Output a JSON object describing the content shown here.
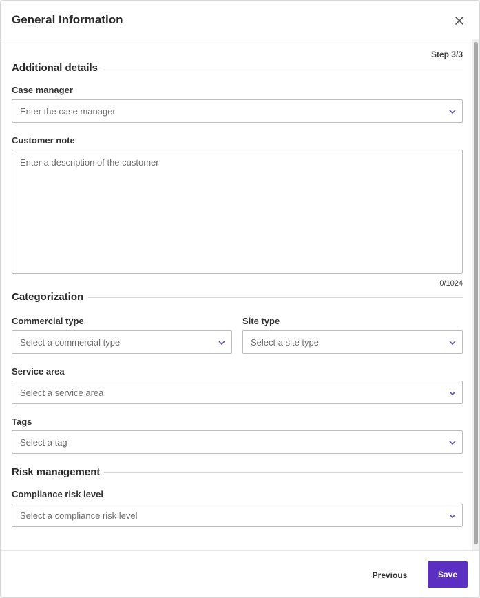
{
  "dialog": {
    "title": "General Information",
    "close_icon": "close-icon",
    "step": "Step 3/3"
  },
  "sections": {
    "additional": "Additional details",
    "categorization": "Categorization",
    "risk": "Risk management"
  },
  "fields": {
    "case_manager": {
      "label": "Case manager",
      "placeholder": "Enter the case manager"
    },
    "customer_note": {
      "label": "Customer note",
      "placeholder": "Enter a description of the customer",
      "counter": "0/1024"
    },
    "commercial_type": {
      "label": "Commercial type",
      "placeholder": "Select a commercial type"
    },
    "site_type": {
      "label": "Site type",
      "placeholder": "Select a site type"
    },
    "service_area": {
      "label": "Service area",
      "placeholder": "Select a service area"
    },
    "tags": {
      "label": "Tags",
      "placeholder": "Select a tag"
    },
    "compliance_risk": {
      "label": "Compliance risk level",
      "placeholder": "Select a compliance risk level"
    }
  },
  "footer": {
    "previous_label": "Previous",
    "save_label": "Save"
  },
  "colors": {
    "primary": "#5a2fc2",
    "chevron": "#6b4fbb",
    "border": "#bdbdbd"
  }
}
